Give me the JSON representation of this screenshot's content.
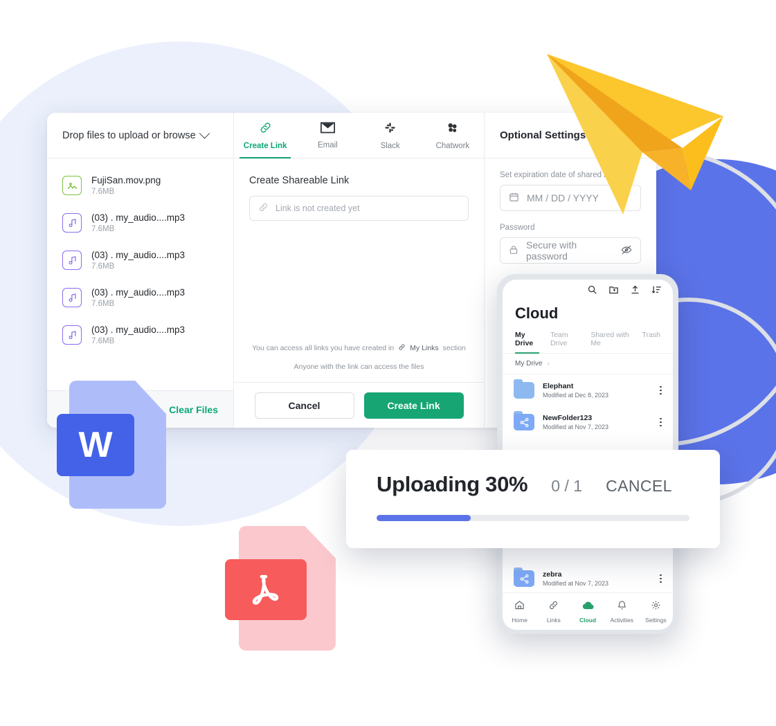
{
  "files_panel": {
    "drop_header": "Drop files to upload or browse",
    "chevron_icon": "chevron-down-icon",
    "files": [
      {
        "name": "FujiSan.mov.png",
        "size": "7.6MB",
        "icon": "image-file-icon",
        "type": "image"
      },
      {
        "name": "(03) . my_audio....mp3",
        "size": "7.6MB",
        "icon": "audio-file-icon",
        "type": "audio"
      },
      {
        "name": "(03) . my_audio....mp3",
        "size": "7.6MB",
        "icon": "audio-file-icon",
        "type": "audio"
      },
      {
        "name": "(03) . my_audio....mp3",
        "size": "7.6MB",
        "icon": "audio-file-icon",
        "type": "audio"
      },
      {
        "name": "(03) . my_audio....mp3",
        "size": "7.6MB",
        "icon": "audio-file-icon",
        "type": "audio"
      }
    ],
    "clear_files": "Clear Files"
  },
  "share_panel": {
    "tabs": [
      {
        "label": "Create Link",
        "icon": "link-icon",
        "active": true
      },
      {
        "label": "Email",
        "icon": "envelope-icon",
        "active": false
      },
      {
        "label": "Slack",
        "icon": "slack-icon",
        "active": false
      },
      {
        "label": "Chatwork",
        "icon": "chatwork-icon",
        "active": false
      }
    ],
    "section_title": "Create Shareable Link",
    "link_placeholder": "Link is not created yet",
    "link_icon": "link-icon",
    "note_prefix": "You can access all links you have created in",
    "note_link": "My Links",
    "note_suffix": "section",
    "note_secondary": "Anyone with the link can access the files",
    "cancel_label": "Cancel",
    "create_label": "Create Link"
  },
  "optional_panel": {
    "title": "Optional Settings",
    "expiration_label": "Set expiration date of shared l",
    "date_placeholder": "MM / DD / YYYY",
    "calendar_icon": "calendar-icon",
    "password_label": "Password",
    "password_placeholder": "Secure with password",
    "lock_icon": "lock-icon",
    "eye_icon": "eye-off-icon"
  },
  "phone": {
    "top_icons": [
      "search-icon",
      "new-folder-icon",
      "upload-icon",
      "sort-icon"
    ],
    "brand": "Cloud",
    "tabs": [
      {
        "label": "My Drive",
        "active": true
      },
      {
        "label": "Team Drive",
        "active": false
      },
      {
        "label": "Shared with Me",
        "active": false
      },
      {
        "label": "Trash",
        "active": false
      }
    ],
    "breadcrumb": "My Drive",
    "breadcrumb_arrow": "chevron-right-icon",
    "rows": [
      {
        "name": "Elephant",
        "modified": "Modified at Dec 8, 2023",
        "icon": "folder-icon",
        "shared": false
      },
      {
        "name": "NewFolder123",
        "modified": "Modified at Nov 7, 2023",
        "icon": "shared-folder-icon",
        "shared": true
      },
      {
        "name": "zebra",
        "modified": "Modified at Nov 7, 2023",
        "icon": "shared-folder-icon",
        "shared": true
      }
    ],
    "nav": [
      {
        "label": "Home",
        "icon": "home-icon",
        "active": false
      },
      {
        "label": "Links",
        "icon": "link-icon",
        "active": false
      },
      {
        "label": "Cloud",
        "icon": "cloud-icon",
        "active": true
      },
      {
        "label": "Activities",
        "icon": "bell-icon",
        "active": false
      },
      {
        "label": "Settings",
        "icon": "gear-icon",
        "active": false
      }
    ]
  },
  "upload_toast": {
    "title": "Uploading 30%",
    "count": "0 / 1",
    "cancel": "CANCEL",
    "progress_percent": 30
  },
  "decorations": {
    "word_badge_letter": "W",
    "pdf_badge_icon": "acrobat-icon",
    "plane_icon": "paper-plane-icon"
  },
  "colors": {
    "accent_green": "#17A673",
    "accent_blue": "#5B73E8",
    "pale_blue": "#EBF0FC",
    "plane_yellow": "#FCC62D",
    "word_blue": "#4362E8",
    "pdf_red": "#F75B5B"
  }
}
